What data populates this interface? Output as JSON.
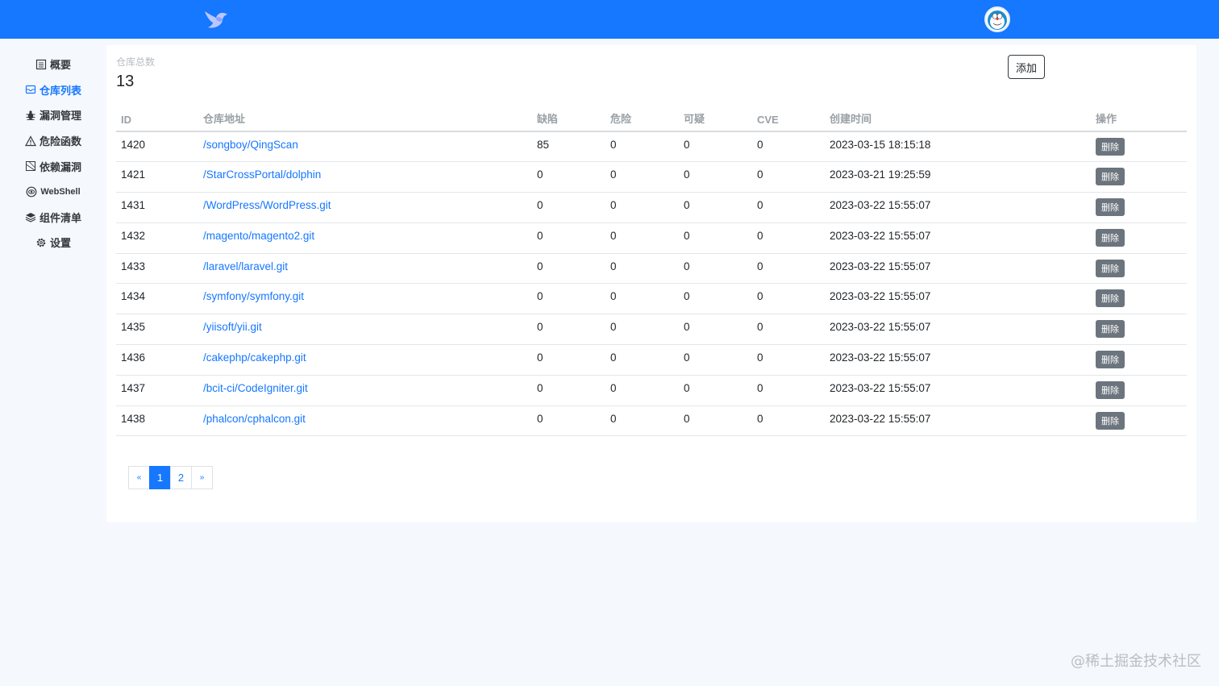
{
  "header": {
    "logo_icon": "bird-logo-icon",
    "avatar_icon": "doraemon-avatar-icon",
    "bg_color": "#1677ff"
  },
  "sidebar": {
    "items": [
      {
        "label": "概要",
        "icon": "list-icon"
      },
      {
        "label": "仓库列表",
        "icon": "inbox-icon",
        "active": true
      },
      {
        "label": "漏洞管理",
        "icon": "bug-icon"
      },
      {
        "label": "危险函数",
        "icon": "warning-icon"
      },
      {
        "label": "依赖漏洞",
        "icon": "package-icon"
      },
      {
        "label": "WebShell",
        "icon": "eye-icon"
      },
      {
        "label": "组件清单",
        "icon": "layers-icon"
      },
      {
        "label": "设置",
        "icon": "gear-icon"
      }
    ]
  },
  "summary": {
    "label": "仓库总数",
    "value": "13",
    "add_label": "添加"
  },
  "table": {
    "headers": [
      "ID",
      "仓库地址",
      "缺陷",
      "危险",
      "可疑",
      "CVE",
      "创建时间",
      "操作"
    ],
    "delete_label": "删除",
    "rows": [
      {
        "id": "1420",
        "repo": "/songboy/QingScan",
        "defect": "85",
        "danger": "0",
        "suspicious": "0",
        "cve": "0",
        "created": "2023-03-15 18:15:18"
      },
      {
        "id": "1421",
        "repo": "/StarCrossPortal/dolphin",
        "defect": "0",
        "danger": "0",
        "suspicious": "0",
        "cve": "0",
        "created": "2023-03-21 19:25:59"
      },
      {
        "id": "1431",
        "repo": "/WordPress/WordPress.git",
        "defect": "0",
        "danger": "0",
        "suspicious": "0",
        "cve": "0",
        "created": "2023-03-22 15:55:07"
      },
      {
        "id": "1432",
        "repo": "/magento/magento2.git",
        "defect": "0",
        "danger": "0",
        "suspicious": "0",
        "cve": "0",
        "created": "2023-03-22 15:55:07"
      },
      {
        "id": "1433",
        "repo": "/laravel/laravel.git",
        "defect": "0",
        "danger": "0",
        "suspicious": "0",
        "cve": "0",
        "created": "2023-03-22 15:55:07"
      },
      {
        "id": "1434",
        "repo": "/symfony/symfony.git",
        "defect": "0",
        "danger": "0",
        "suspicious": "0",
        "cve": "0",
        "created": "2023-03-22 15:55:07"
      },
      {
        "id": "1435",
        "repo": "/yiisoft/yii.git",
        "defect": "0",
        "danger": "0",
        "suspicious": "0",
        "cve": "0",
        "created": "2023-03-22 15:55:07"
      },
      {
        "id": "1436",
        "repo": "/cakephp/cakephp.git",
        "defect": "0",
        "danger": "0",
        "suspicious": "0",
        "cve": "0",
        "created": "2023-03-22 15:55:07"
      },
      {
        "id": "1437",
        "repo": "/bcit-ci/CodeIgniter.git",
        "defect": "0",
        "danger": "0",
        "suspicious": "0",
        "cve": "0",
        "created": "2023-03-22 15:55:07"
      },
      {
        "id": "1438",
        "repo": "/phalcon/cphalcon.git",
        "defect": "0",
        "danger": "0",
        "suspicious": "0",
        "cve": "0",
        "created": "2023-03-22 15:55:07"
      }
    ]
  },
  "pagination": {
    "prev": "«",
    "pages": [
      "1",
      "2"
    ],
    "current": "1",
    "next": "»"
  },
  "watermark": "@稀土掘金技术社区"
}
